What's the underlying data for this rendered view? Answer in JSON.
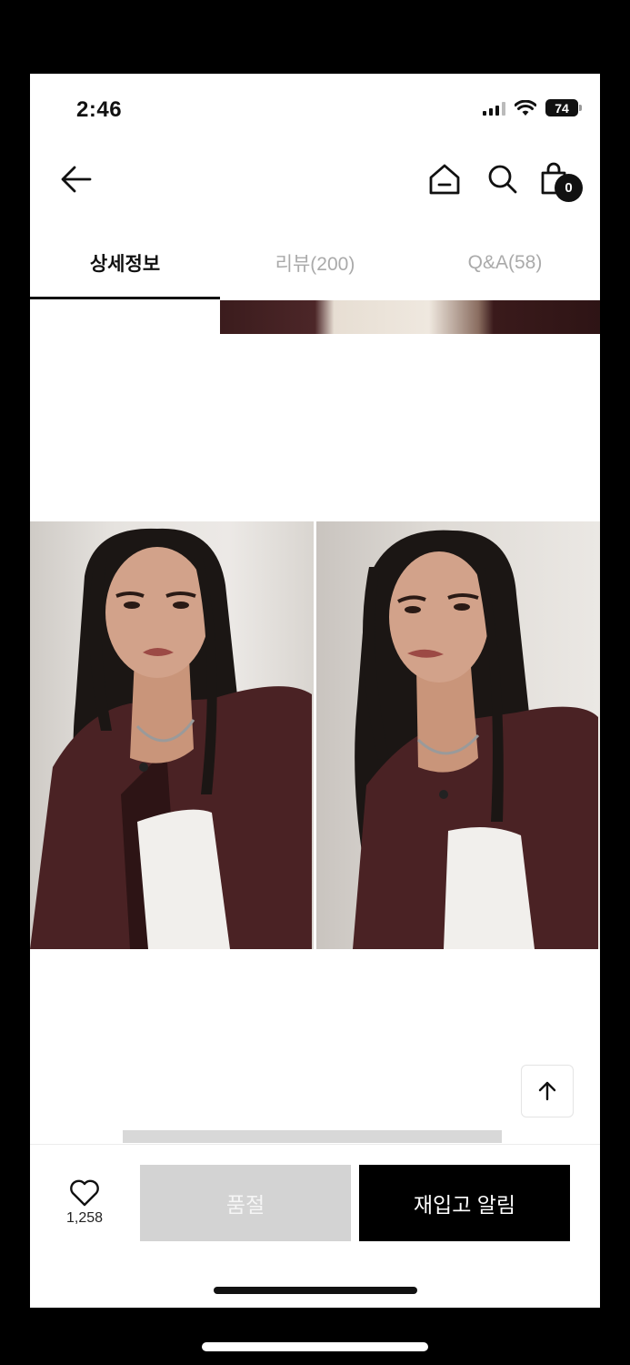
{
  "status_bar": {
    "time": "2:46",
    "battery": "74"
  },
  "header": {
    "back_icon": "arrow-left-icon",
    "home_icon": "home-icon",
    "search_icon": "search-icon",
    "cart_icon": "shopping-bag-icon",
    "cart_count": "0"
  },
  "tabs": [
    {
      "label": "상세정보",
      "active": true
    },
    {
      "label": "리뷰(200)",
      "active": false
    },
    {
      "label": "Q&A(58)",
      "active": false
    }
  ],
  "scroll_top_icon": "arrow-up-icon",
  "bottom_bar": {
    "like_icon": "heart-icon",
    "like_count": "1,258",
    "soldout_label": "품절",
    "restock_label": "재입고 알림"
  }
}
